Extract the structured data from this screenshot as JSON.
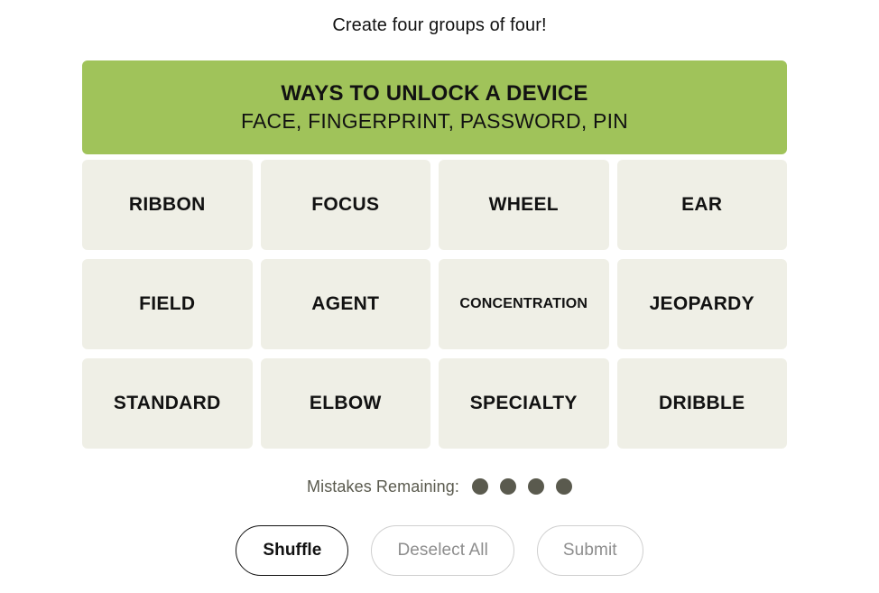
{
  "header": {
    "instruction": "Create four groups of four!"
  },
  "solved_groups": [
    {
      "category": "WAYS TO UNLOCK A DEVICE",
      "words": "FACE, FINGERPRINT, PASSWORD, PIN",
      "color": "#a0c35a"
    }
  ],
  "grid": {
    "tiles": [
      {
        "label": "RIBBON",
        "size": "normal"
      },
      {
        "label": "FOCUS",
        "size": "normal"
      },
      {
        "label": "WHEEL",
        "size": "normal"
      },
      {
        "label": "EAR",
        "size": "normal"
      },
      {
        "label": "FIELD",
        "size": "normal"
      },
      {
        "label": "AGENT",
        "size": "normal"
      },
      {
        "label": "CONCENTRATION",
        "size": "small"
      },
      {
        "label": "JEOPARDY",
        "size": "normal"
      },
      {
        "label": "STANDARD",
        "size": "normal"
      },
      {
        "label": "ELBOW",
        "size": "normal"
      },
      {
        "label": "SPECIALTY",
        "size": "normal"
      },
      {
        "label": "DRIBBLE",
        "size": "normal"
      }
    ],
    "tile_color": "#efefe6"
  },
  "mistakes": {
    "label": "Mistakes Remaining:",
    "remaining": 4,
    "dot_color": "#5a5a4e"
  },
  "actions": {
    "shuffle": {
      "label": "Shuffle",
      "state": "enabled"
    },
    "deselect_all": {
      "label": "Deselect All",
      "state": "disabled"
    },
    "submit": {
      "label": "Submit",
      "state": "disabled"
    }
  }
}
